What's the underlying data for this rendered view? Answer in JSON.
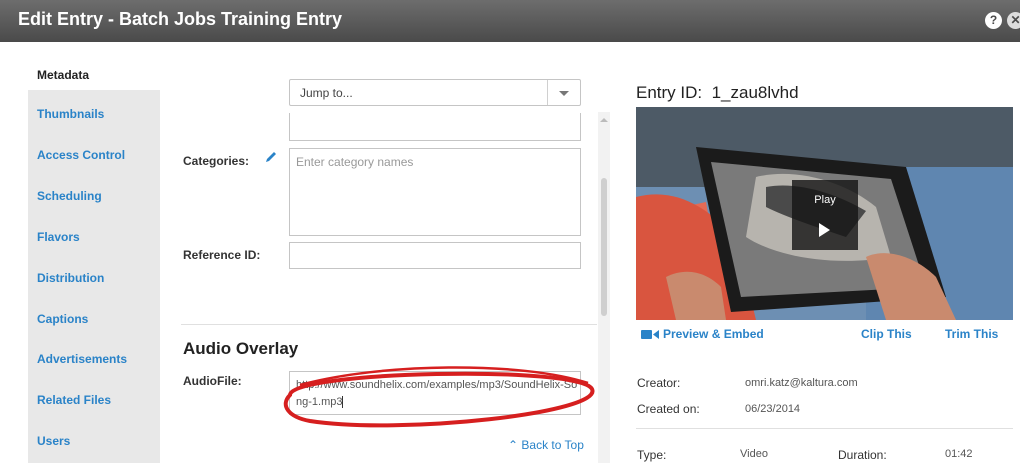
{
  "window": {
    "title": "Edit Entry - Batch Jobs Training Entry",
    "help": "?",
    "close": "✕"
  },
  "sidebar": {
    "items": [
      {
        "label": "Metadata",
        "active": true
      },
      {
        "label": "Thumbnails"
      },
      {
        "label": "Access Control"
      },
      {
        "label": "Scheduling"
      },
      {
        "label": "Flavors"
      },
      {
        "label": "Distribution"
      },
      {
        "label": "Captions"
      },
      {
        "label": "Advertisements"
      },
      {
        "label": "Related Files"
      },
      {
        "label": "Users"
      }
    ]
  },
  "form": {
    "jump_to": "Jump to...",
    "categories_label": "Categories:",
    "categories_placeholder": "Enter category names",
    "reference_label": "Reference ID:",
    "reference_value": "",
    "section_title": "Audio Overlay",
    "audiofile_label": "AudioFile:",
    "audiofile_value": "http://www.soundhelix.com/examples/mp3/SoundHelix-Song-1.mp3",
    "back_to_top": "Back to Top"
  },
  "entry": {
    "id_label": "Entry ID:",
    "id_value": "1_zau8lvhd",
    "play_label": "Play",
    "links": {
      "preview_embed": "Preview & Embed",
      "clip": "Clip This",
      "trim": "Trim This"
    },
    "creator_label": "Creator:",
    "creator_value": "omri.katz@kaltura.com",
    "created_on_label": "Created on:",
    "created_on_value": "06/23/2014",
    "type_label": "Type:",
    "type_value": "Video",
    "duration_label": "Duration:",
    "duration_value": "01:42"
  },
  "colors": {
    "link": "#2a83c8",
    "titlebar": "#555555",
    "sidebar": "#e8e8e8",
    "annotation": "#d61f1f"
  },
  "icons": [
    "pencil-icon",
    "chevron-down-icon",
    "video-camera-icon",
    "chevron-up-icon",
    "help-icon",
    "close-icon",
    "play-icon"
  ]
}
